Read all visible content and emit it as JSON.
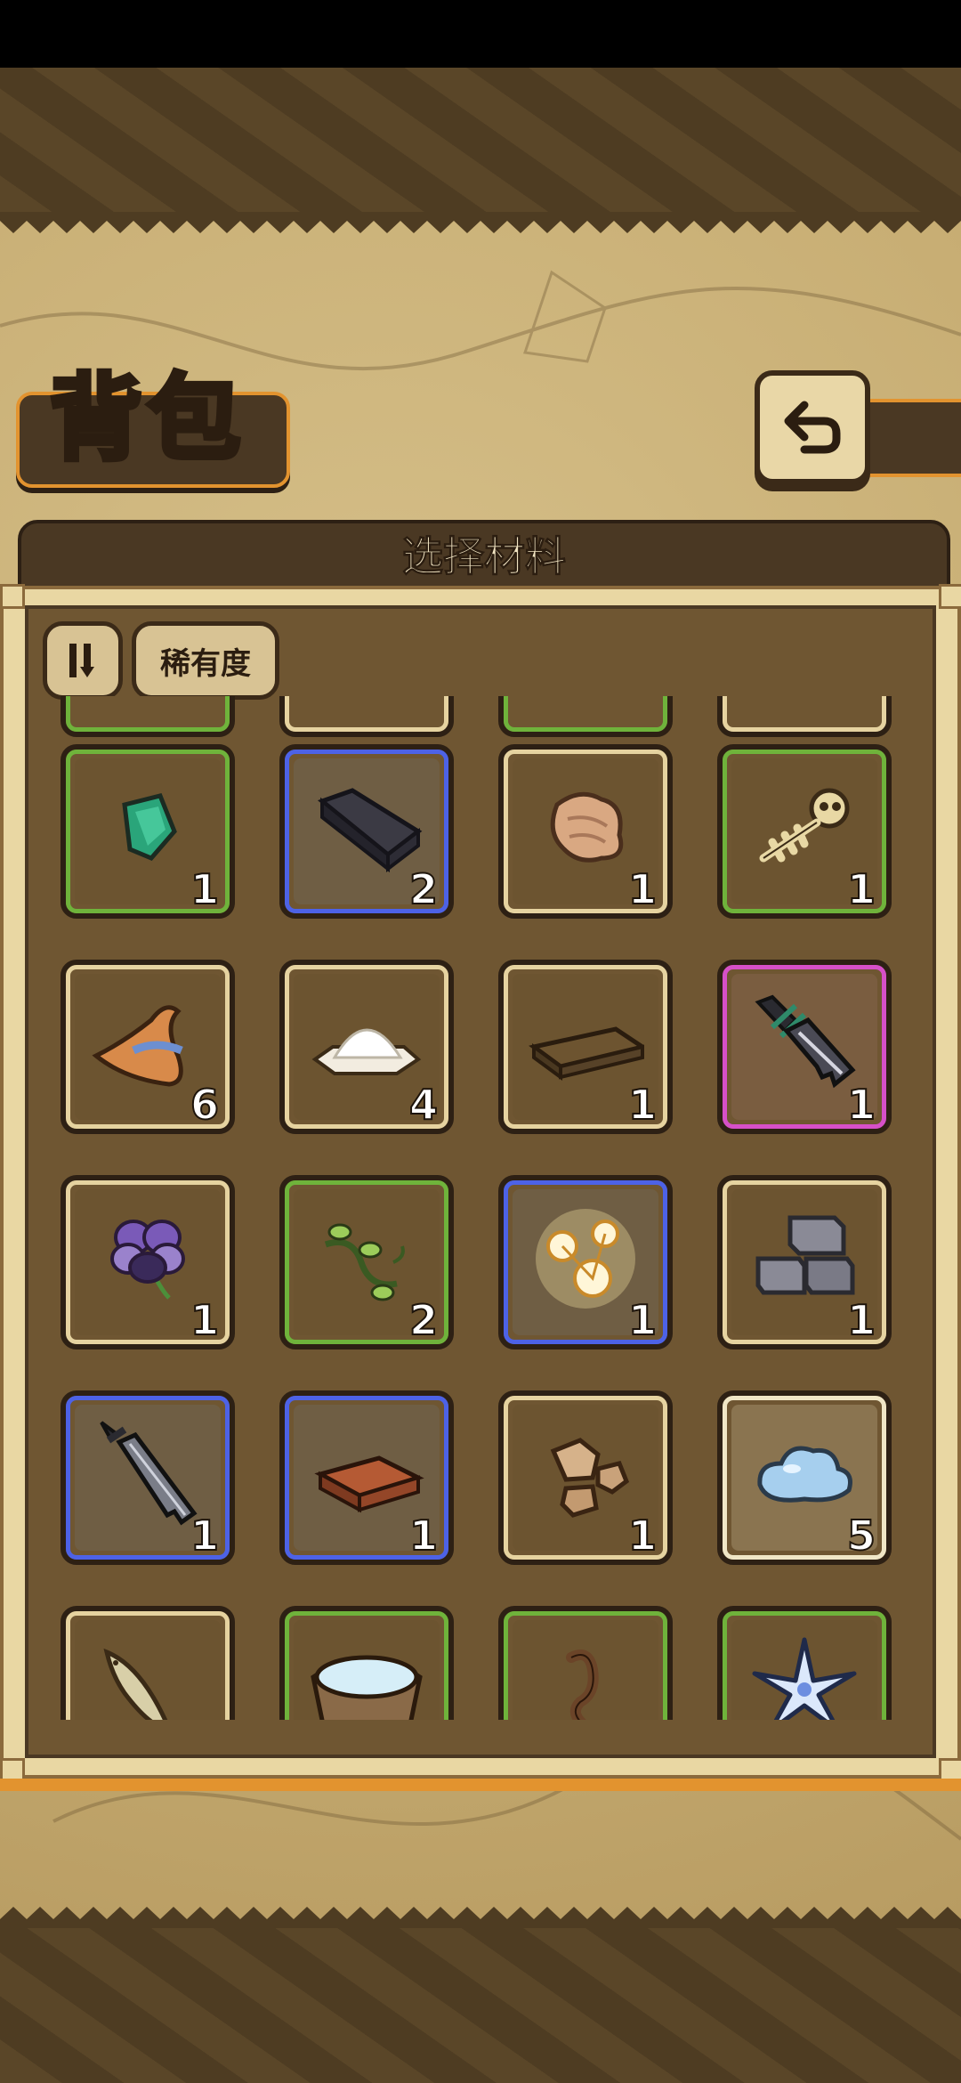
{
  "header": {
    "title": "背包",
    "back_icon": "return-arrow-icon"
  },
  "panel": {
    "title": "选择材料",
    "sort_icon": "sort-toggle-icon",
    "rarity_label": "稀有度"
  },
  "colors": {
    "common": "#e6d3a0",
    "uncommon": "#6fb33b",
    "rare": "#4d62e6",
    "epic": "#d650c8",
    "special": "#f0e6c6"
  },
  "items": [
    {
      "icon": "green-gem-icon",
      "rarity": "green",
      "count": "1"
    },
    {
      "icon": "dark-ingot-icon",
      "rarity": "blue",
      "count": "2"
    },
    {
      "icon": "fur-pelt-icon",
      "rarity": "beige",
      "count": "1"
    },
    {
      "icon": "skeleton-bones-icon",
      "rarity": "green",
      "count": "1"
    },
    {
      "icon": "witch-hat-icon",
      "rarity": "beige",
      "count": "6"
    },
    {
      "icon": "white-powder-icon",
      "rarity": "beige",
      "count": "4"
    },
    {
      "icon": "wood-plank-icon",
      "rarity": "beige",
      "count": "1"
    },
    {
      "icon": "broken-sword-icon",
      "rarity": "purple",
      "count": "1"
    },
    {
      "icon": "purple-pansy-flower-icon",
      "rarity": "beige",
      "count": "1"
    },
    {
      "icon": "green-vine-icon",
      "rarity": "green",
      "count": "2"
    },
    {
      "icon": "glowing-orbs-icon",
      "rarity": "blue",
      "count": "1"
    },
    {
      "icon": "stone-bricks-icon",
      "rarity": "beige",
      "count": "1"
    },
    {
      "icon": "dagger-blade-icon",
      "rarity": "blue",
      "count": "1"
    },
    {
      "icon": "clay-brick-icon",
      "rarity": "blue",
      "count": "1"
    },
    {
      "icon": "rock-pile-icon",
      "rarity": "beige",
      "count": "1"
    },
    {
      "icon": "blue-slime-icon",
      "rarity": "white",
      "count": "5"
    },
    {
      "icon": "fish-icon",
      "rarity": "beige",
      "count": ""
    },
    {
      "icon": "water-bowl-icon",
      "rarity": "green",
      "count": ""
    },
    {
      "icon": "rope-coil-icon",
      "rarity": "green",
      "count": ""
    },
    {
      "icon": "blue-star-flower-icon",
      "rarity": "green",
      "count": ""
    }
  ]
}
